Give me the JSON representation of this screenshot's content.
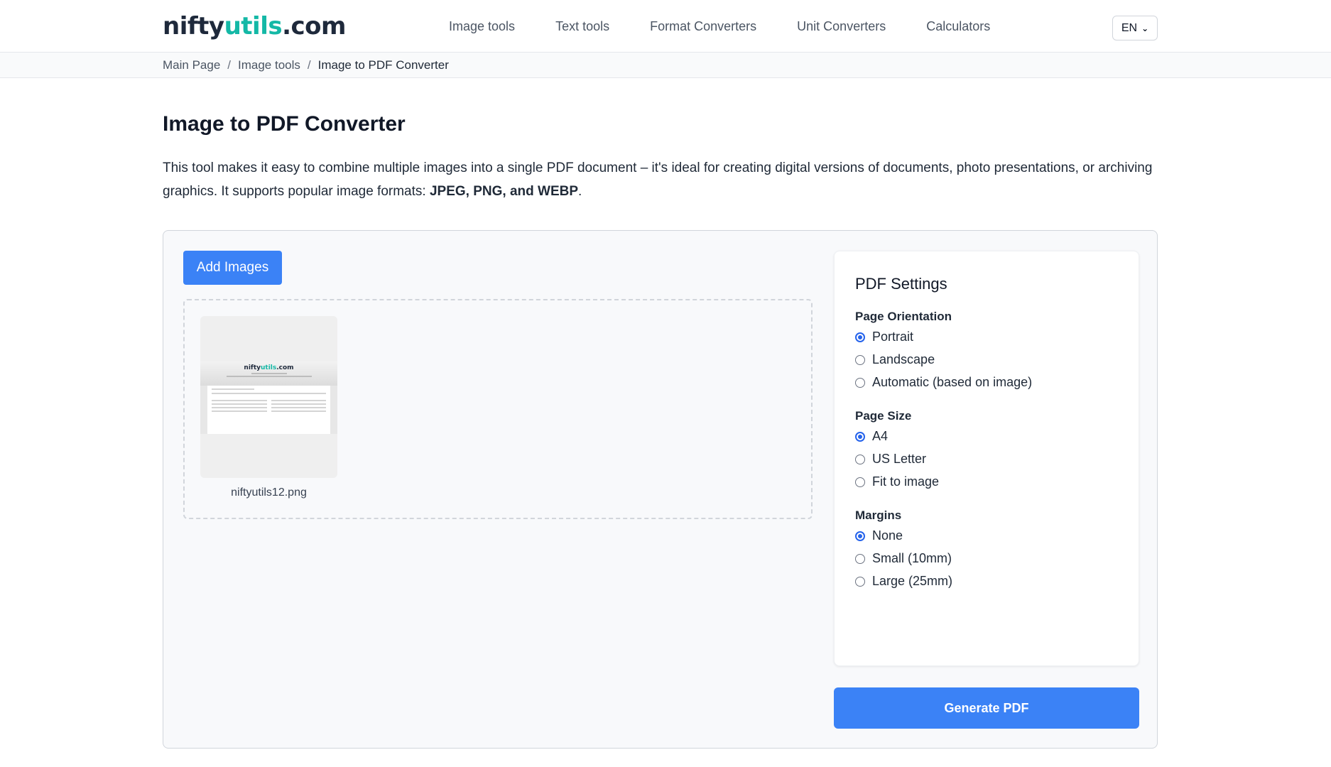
{
  "header": {
    "logo": {
      "part1": "nifty",
      "part2": "utils",
      "part3": ".com"
    },
    "nav": [
      "Image tools",
      "Text tools",
      "Format Converters",
      "Unit Converters",
      "Calculators"
    ],
    "language": "EN"
  },
  "breadcrumb": [
    "Main Page",
    "Image tools",
    "Image to PDF Converter"
  ],
  "page": {
    "title": "Image to PDF Converter",
    "intro_text": "This tool makes it easy to combine multiple images into a single PDF document – it's ideal for creating digital versions of documents, photo presentations, or archiving graphics. It supports popular image formats: ",
    "formats": "JPEG, PNG, and WEBP",
    "intro_end": "."
  },
  "uploader": {
    "add_button": "Add Images",
    "files": [
      {
        "name": "niftyutils12.png"
      }
    ]
  },
  "thumbnail_preview": {
    "logo": {
      "part1": "nifty",
      "part2": "utils",
      "part3": ".com"
    }
  },
  "settings": {
    "title": "PDF Settings",
    "orientation": {
      "label": "Page Orientation",
      "options": [
        "Portrait",
        "Landscape",
        "Automatic (based on image)"
      ],
      "selected": "Portrait"
    },
    "page_size": {
      "label": "Page Size",
      "options": [
        "A4",
        "US Letter",
        "Fit to image"
      ],
      "selected": "A4"
    },
    "margins": {
      "label": "Margins",
      "options": [
        "None",
        "Small (10mm)",
        "Large (25mm)"
      ],
      "selected": "None"
    },
    "generate_button": "Generate PDF"
  },
  "colors": {
    "primary": "#3b82f6",
    "logo_accent": "#14b8a6",
    "radio_selected": "#2563eb"
  }
}
